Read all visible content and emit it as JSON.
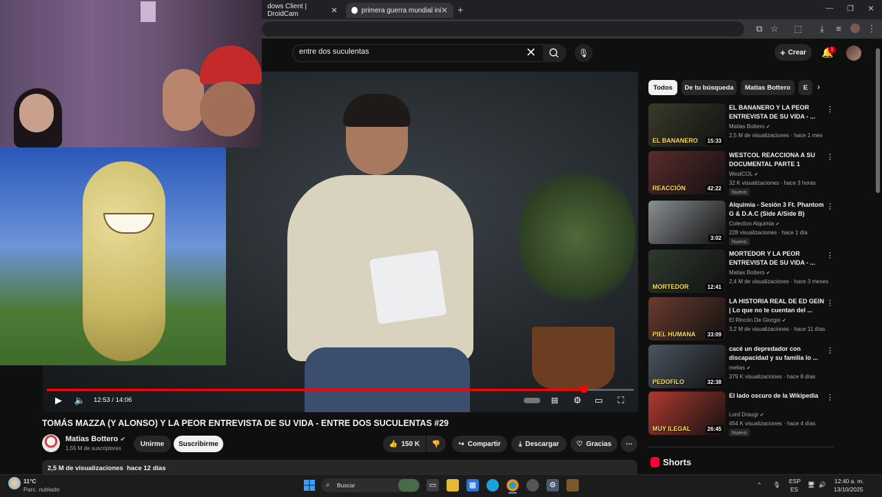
{
  "browser": {
    "tabs": [
      {
        "label": "dows Client | DroidCam"
      },
      {
        "label": "primera guerra mundial inicio -"
      }
    ]
  },
  "youtube": {
    "search": {
      "query": "entre dos suculentas"
    },
    "create_label": "Crear",
    "notification_count": "1"
  },
  "player": {
    "time": "12:53 / 14:06",
    "progress": 0.914
  },
  "video": {
    "title": "TOMÁS MAZZA (Y ALONSO) Y LA PEOR ENTREVISTA DE SU VIDA - ENTRE DOS SUCULENTAS #29",
    "channel": "Matias Bottero",
    "subscribers": "1,55 M de suscriptores",
    "join_label": "Unirme",
    "subscribe_label": "Suscribirme",
    "likes": "150 K",
    "share_label": "Compartir",
    "download_label": "Descargar",
    "thanks_label": "Gracias",
    "views": "2,5 M de visualizaciones",
    "date": "hace 12 días"
  },
  "chips": [
    "Todos",
    "De tu búsqueda",
    "Matias Bottero",
    "E"
  ],
  "recommendations": [
    {
      "title": "EL BANANERO Y LA PEOR ENTREVISTA DE SU VIDA - ...",
      "channel": "Matias Bottero",
      "meta": "2,5 M de visualizaciones · hace 1 mes",
      "duration": "15:33",
      "thumb_text": "EL BANANERO",
      "badge": "",
      "color": "#3a3a2a"
    },
    {
      "title": "WESTCOL REACCIONA A SU DOCUMENTAL PARTE 1",
      "channel": "WestCOL",
      "meta": "32 K visualizaciones · hace 3 horas",
      "duration": "42:22",
      "thumb_text": "REACCIÓN",
      "badge": "Nuevo",
      "color": "#5a2b2b"
    },
    {
      "title": "Alquimia - Sesión 3 Ft. Phantom G & D.A.C (Side A/Side B)",
      "channel": "Colectivo Alquimia",
      "meta": "228 visualizaciones · hace 1 día",
      "duration": "3:02",
      "thumb_text": "",
      "badge": "Nuevo",
      "color": "#8a8f92"
    },
    {
      "title": "MORTEDOR Y LA PEOR ENTREVISTA DE SU VIDA - ...",
      "channel": "Matias Bottero",
      "meta": "2,4 M de visualizaciones · hace 3 meses",
      "duration": "12:41",
      "thumb_text": "MORTEDOR",
      "badge": "",
      "color": "#2f3a2e"
    },
    {
      "title": "LA HISTORIA REAL DE ED GEIN | Lo que no te cuentan del ...",
      "channel": "El Rincón De Giorgio",
      "meta": "3,2 M de visualizaciones · hace 11 días",
      "duration": "33:09",
      "thumb_text": "PIEL HUMANA",
      "badge": "",
      "color": "#6b3b2e"
    },
    {
      "title": "cacé un depredador con discapacidad y su familia lo ...",
      "channel": "melias",
      "meta": "379 K visualizaciones · hace 8 días",
      "duration": "32:38",
      "thumb_text": "PEDOFILO",
      "badge": "",
      "color": "#4a5560"
    },
    {
      "title": "El lado oscuro de la Wikipedia",
      "channel": "Lord Draugr",
      "meta": "454 K visualizaciones · hace 4 días",
      "duration": "26:45",
      "thumb_text": "MUY ILEGAL",
      "badge": "Nuevo",
      "color": "#b03a2e"
    }
  ],
  "shorts_label": "Shorts",
  "taskbar": {
    "weather_temp": "11°C",
    "weather_desc": "Parc. nublado",
    "search_label": "Buscar",
    "lang_top": "ESP",
    "lang_bottom": "ES",
    "clock_time": "12:40 a. m.",
    "clock_date": "13/10/2025"
  }
}
